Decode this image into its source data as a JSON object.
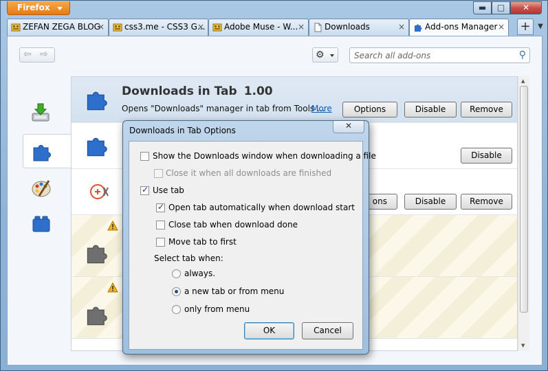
{
  "app": {
    "menu_label": "Firefox"
  },
  "window_controls": {
    "minimize": "▬",
    "maximize": "□",
    "close": "✕"
  },
  "tabs": [
    {
      "label": "ZEFAN ZEGA BLOG"
    },
    {
      "label": "css3.me - CSS3 G..."
    },
    {
      "label": "Adobe Muse - W..."
    },
    {
      "label": "Downloads"
    },
    {
      "label": "Add-ons Manager"
    }
  ],
  "tab_close_glyph": "×",
  "new_tab_glyph": "+",
  "tab_list_glyph": "▼",
  "toolbar": {
    "back_glyph": "⇦",
    "forward_glyph": "⇨",
    "gear_glyph": "⚙",
    "search_placeholder": "Search all add-ons",
    "search_glyph": "⚲"
  },
  "addons": {
    "first": {
      "title": "Downloads in Tab",
      "version": "1.00",
      "description": "Opens \"Downloads\" manager in tab from Tools ...",
      "more_label": "More",
      "options_label": "Options",
      "disable_label": "Disable",
      "remove_label": "Remove"
    },
    "second": {
      "disable_label": "Disable"
    },
    "third": {
      "options_fragment": "ons",
      "disable_label": "Disable",
      "remove_label": "Remove"
    }
  },
  "dialog": {
    "title": "Downloads in Tab Options",
    "close_glyph": "✕",
    "options": {
      "show_window": "Show the Downloads window when downloading a file",
      "close_when_finished": "Close it when all downloads are finished",
      "use_tab": "Use tab",
      "open_tab_auto": "Open tab automatically when download start",
      "close_tab_done": "Close tab when download done",
      "move_tab_first": "Move tab to first",
      "select_tab_when": "Select tab when:",
      "always": "always.",
      "new_tab_or_menu": "a new tab or from menu",
      "only_from_menu": "only from menu"
    },
    "check_glyph": "✓",
    "ok_label": "OK",
    "cancel_label": "Cancel"
  },
  "colors": {
    "firefox_orange": "#e57b14",
    "selected_item": "#d3e1ef",
    "warning_stripe": "#f4efd8",
    "link": "#0a57b8"
  }
}
